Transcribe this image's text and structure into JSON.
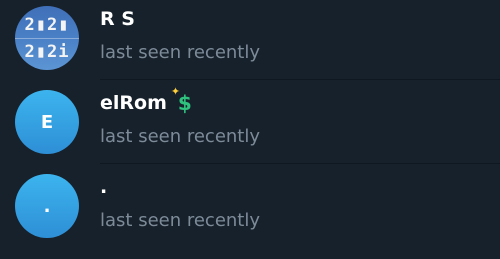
{
  "contacts": [
    {
      "name": "R S",
      "status": "last seen recently",
      "avatar": {
        "type": "photo",
        "lines": [
          "2▮2▮",
          "2▮2i"
        ]
      }
    },
    {
      "name": "elRom",
      "status": "last seen recently",
      "status_emoji": "dollar-sparkle-icon",
      "avatar": {
        "type": "initial",
        "initial": "E",
        "color": "#3aa9e8"
      }
    },
    {
      "name": ".",
      "status": "last seen recently",
      "avatar": {
        "type": "initial",
        "initial": ".",
        "color": "#3aa9e8"
      }
    }
  ],
  "colors": {
    "background": "#17212b",
    "name_text": "#ffffff",
    "status_text": "#7d8b99",
    "avatar_blue": "#3aa9e8"
  }
}
